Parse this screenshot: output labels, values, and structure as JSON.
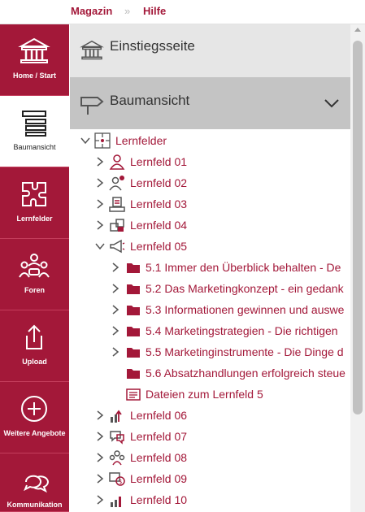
{
  "breadcrumb": {
    "magazin": "Magazin",
    "separator": "»",
    "hilfe": "Hilfe"
  },
  "sidebar": {
    "items": [
      {
        "label": "Home / Start",
        "icon": "home-icon"
      },
      {
        "label": "Baumansicht",
        "icon": "tree-view-icon"
      },
      {
        "label": "Lernfelder",
        "icon": "puzzle-icon"
      },
      {
        "label": "Foren",
        "icon": "forum-users-icon"
      },
      {
        "label": "Upload",
        "icon": "upload-icon"
      },
      {
        "label": "Weitere Angebote",
        "icon": "plus-circle-icon"
      },
      {
        "label": "Kommunikation",
        "icon": "chat-bubbles-icon"
      }
    ]
  },
  "sections": {
    "einstieg": "Einstiegsseite",
    "baum": "Baumansicht"
  },
  "tree": {
    "root": "Lernfelder",
    "items": [
      {
        "label": "Lernfeld 01",
        "icon": "person-icon"
      },
      {
        "label": "Lernfeld 02",
        "icon": "person-gear-icon"
      },
      {
        "label": "Lernfeld 03",
        "icon": "desk-icon"
      },
      {
        "label": "Lernfeld 04",
        "icon": "boxes-icon"
      },
      {
        "label": "Lernfeld 05",
        "icon": "megaphone-icon"
      },
      {
        "label": "5.1 Immer den Überblick behalten - De",
        "icon": "folder-icon"
      },
      {
        "label": "5.2 Das Marketingkonzept - ein gedank",
        "icon": "folder-icon"
      },
      {
        "label": "5.3 Informationen gewinnen und auswe",
        "icon": "folder-icon"
      },
      {
        "label": "5.4 Marketingstrategien - Die richtigen",
        "icon": "folder-icon"
      },
      {
        "label": "5.5 Marketinginstrumente - Die Dinge d",
        "icon": "folder-icon"
      },
      {
        "label": "5.6 Absatzhandlungen erfolgreich steue",
        "icon": "folder-icon"
      },
      {
        "label": "Dateien zum Lernfeld 5",
        "icon": "files-icon"
      },
      {
        "label": "Lernfeld 06",
        "icon": "growth-icon"
      },
      {
        "label": "Lernfeld 07",
        "icon": "speech-icon"
      },
      {
        "label": "Lernfeld 08",
        "icon": "team-icon"
      },
      {
        "label": "Lernfeld 09",
        "icon": "money-icon"
      },
      {
        "label": "Lernfeld 10",
        "icon": "chart-icon"
      }
    ]
  },
  "colors": {
    "brand": "#a31839",
    "active_bg": "#ffffff",
    "section_bg": "#c4c4c4"
  }
}
